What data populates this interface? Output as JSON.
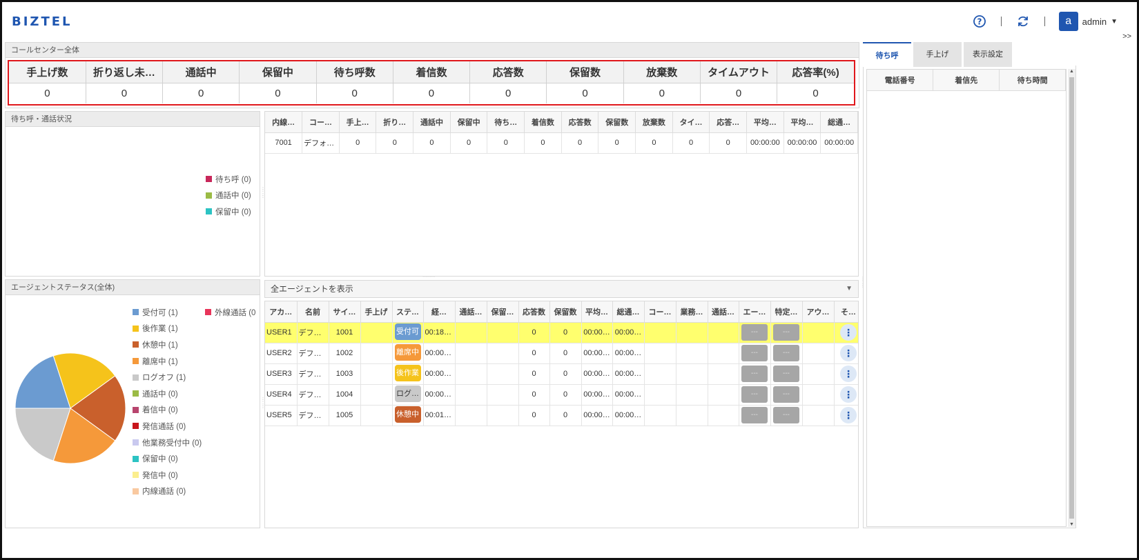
{
  "header": {
    "logo": "BIZTEL",
    "user_initial": "a",
    "user_name": "admin",
    "help_icon": "help-circle-icon",
    "refresh_icon": "refresh-icon",
    "expand_label": ">>"
  },
  "callcenter": {
    "title": "コールセンター全体",
    "columns": [
      "手上げ数",
      "折り返し未…",
      "通話中",
      "保留中",
      "待ち呼数",
      "着信数",
      "応答数",
      "保留数",
      "放棄数",
      "タイムアウト",
      "応答率(%)"
    ],
    "values": [
      "0",
      "0",
      "0",
      "0",
      "0",
      "0",
      "0",
      "0",
      "0",
      "0",
      "0"
    ]
  },
  "waiting_status": {
    "title": "待ち呼・通話状況",
    "legend": [
      {
        "label": "待ち呼 (0)",
        "color": "#c8275a"
      },
      {
        "label": "通話中 (0)",
        "color": "#9bbb45"
      },
      {
        "label": "保留中 (0)",
        "color": "#2cc3c3"
      }
    ]
  },
  "extension_table": {
    "headers": [
      "内線…",
      "コー…",
      "手上…",
      "折り…",
      "通話中",
      "保留中",
      "待ち…",
      "着信数",
      "応答数",
      "保留数",
      "放棄数",
      "タイ…",
      "応答…",
      "平均…",
      "平均…",
      "総通…"
    ],
    "rows": [
      [
        "7001",
        "デフォル…",
        "0",
        "0",
        "0",
        "0",
        "0",
        "0",
        "0",
        "0",
        "0",
        "0",
        "0",
        "00:00:00",
        "00:00:00",
        "00:00:00"
      ]
    ]
  },
  "agent_status": {
    "title": "エージェントステータス(全体)",
    "legend_col1": [
      {
        "label": "受付可 (1)",
        "color": "#6b9bd1"
      },
      {
        "label": "後作業 (1)",
        "color": "#f5c31b"
      },
      {
        "label": "休憩中 (1)",
        "color": "#c9602c"
      },
      {
        "label": "離席中 (1)",
        "color": "#f5993a"
      },
      {
        "label": "ログオフ (1)",
        "color": "#c9c9c9"
      },
      {
        "label": "通話中 (0)",
        "color": "#9bbb45"
      },
      {
        "label": "着信中 (0)",
        "color": "#b8456e"
      },
      {
        "label": "発信通話 (0)",
        "color": "#c8151b"
      },
      {
        "label": "他業務受付中 (0)",
        "color": "#c9c9ef"
      },
      {
        "label": "保留中 (0)",
        "color": "#2cc3c3"
      },
      {
        "label": "発信中 (0)",
        "color": "#fbee8e"
      },
      {
        "label": "内線通話 (0)",
        "color": "#f9c9a0"
      }
    ],
    "legend_col2": [
      {
        "label": "外線通話 (0",
        "color": "#e8355a"
      }
    ],
    "pie": [
      {
        "label": "受付可",
        "value": 1,
        "color": "#6b9bd1"
      },
      {
        "label": "後作業",
        "value": 1,
        "color": "#f5c31b"
      },
      {
        "label": "休憩中",
        "value": 1,
        "color": "#c9602c"
      },
      {
        "label": "離席中",
        "value": 1,
        "color": "#f5993a"
      },
      {
        "label": "ログオフ",
        "value": 1,
        "color": "#c9c9c9"
      }
    ]
  },
  "agent_filter": {
    "label": "全エージェントを表示"
  },
  "agent_table": {
    "headers": [
      "アカ…",
      "名前",
      "サイ…",
      "手上げ",
      "ステ…",
      "経…",
      "通話…",
      "保留…",
      "応答数",
      "保留数",
      "平均…",
      "総通…",
      "コー…",
      "業務…",
      "通話…",
      "エー…",
      "特定…",
      "アウ…",
      "そ…"
    ],
    "rows": [
      {
        "account": "USER1",
        "name": "デフォ…",
        "site": "1001",
        "status": "受付可",
        "status_color": "#6b9bd1",
        "elapsed": "00:18…",
        "answered": "0",
        "held": "0",
        "avg": "00:00…",
        "total": "00:00…",
        "btn1": "---",
        "btn2": "---",
        "highlight": true
      },
      {
        "account": "USER2",
        "name": "デフォ…",
        "site": "1002",
        "status": "離席中",
        "status_color": "#f5993a",
        "elapsed": "00:00…",
        "answered": "0",
        "held": "0",
        "avg": "00:00…",
        "total": "00:00…",
        "btn1": "---",
        "btn2": "---",
        "highlight": false
      },
      {
        "account": "USER3",
        "name": "デフォ…",
        "site": "1003",
        "status": "後作業",
        "status_color": "#f5c31b",
        "elapsed": "00:00…",
        "answered": "0",
        "held": "0",
        "avg": "00:00…",
        "total": "00:00…",
        "btn1": "---",
        "btn2": "---",
        "highlight": false
      },
      {
        "account": "USER4",
        "name": "デフォ…",
        "site": "1004",
        "status": "ログ…",
        "status_color": "#c9c9c9",
        "elapsed": "00:00…",
        "answered": "0",
        "held": "0",
        "avg": "00:00…",
        "total": "00:00…",
        "btn1": "---",
        "btn2": "---",
        "highlight": false
      },
      {
        "account": "USER5",
        "name": "デフォ…",
        "site": "1005",
        "status": "休憩中",
        "status_color": "#c9602c",
        "elapsed": "00:01…",
        "answered": "0",
        "held": "0",
        "avg": "00:00…",
        "total": "00:00…",
        "btn1": "---",
        "btn2": "---",
        "highlight": false
      }
    ]
  },
  "right_panel": {
    "tabs": [
      "待ち呼",
      "手上げ",
      "表示設定"
    ],
    "active_tab": 0,
    "headers": [
      "電話番号",
      "着信先",
      "待ち時間"
    ]
  }
}
